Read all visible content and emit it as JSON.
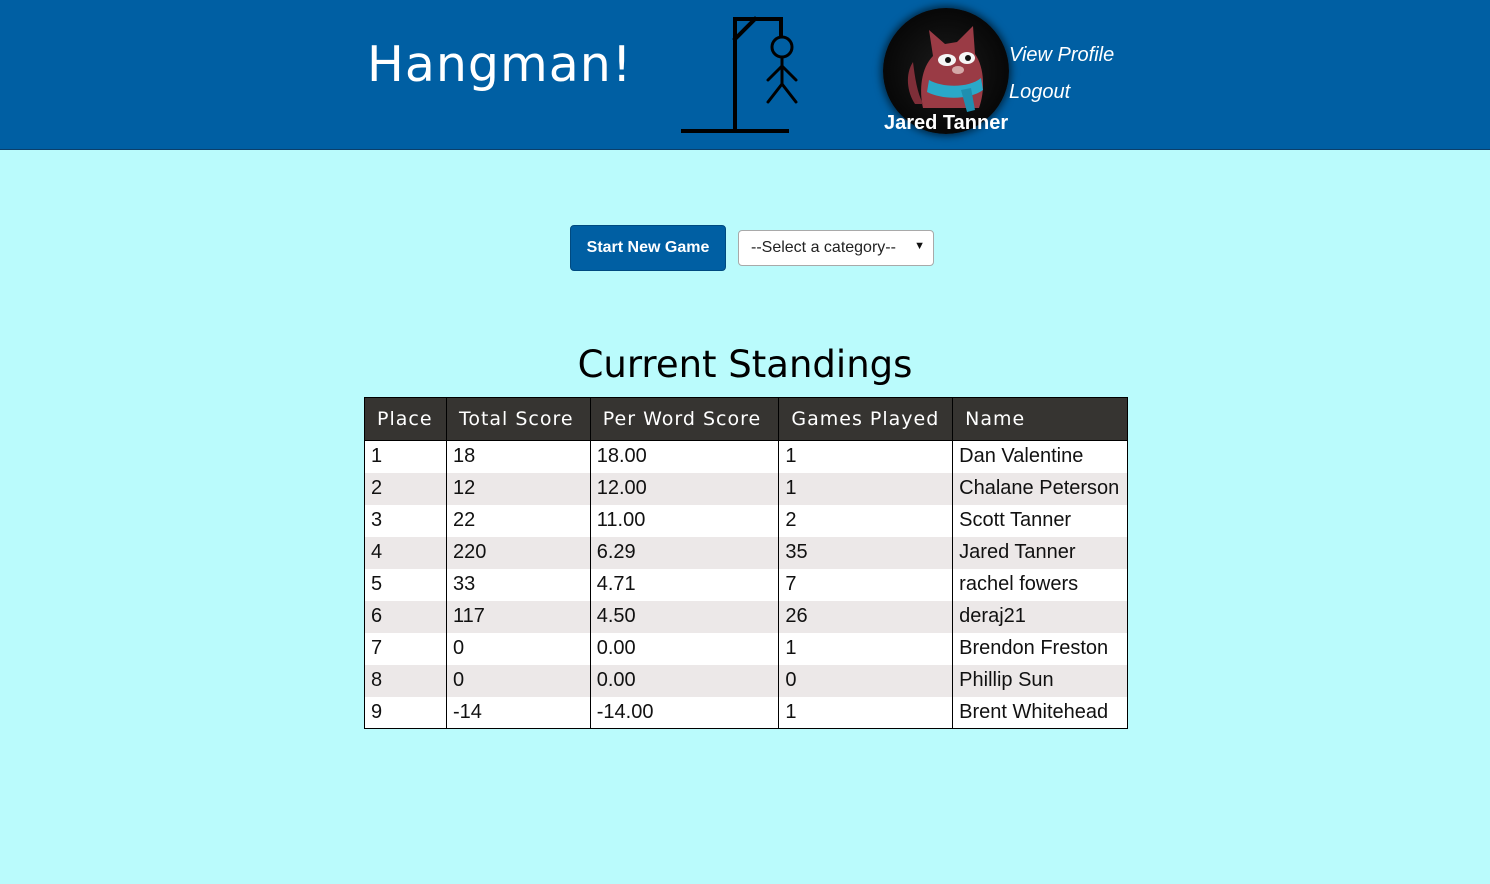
{
  "header": {
    "title": "Hangman!",
    "user_name": "Jared Tanner",
    "nav": {
      "view_profile": "View Profile",
      "logout": "Logout"
    },
    "colors": {
      "header_bg": "#005fa3",
      "page_bg": "#bafbfc"
    }
  },
  "controls": {
    "start_button": "Start New Game",
    "category_select": {
      "selected": "--Select a category--"
    }
  },
  "standings": {
    "title": "Current Standings",
    "columns": [
      "Place",
      "Total Score",
      "Per Word Score",
      "Games Played",
      "Name"
    ],
    "rows": [
      [
        "1",
        "18",
        "18.00",
        "1",
        "Dan Valentine"
      ],
      [
        "2",
        "12",
        "12.00",
        "1",
        "Chalane Peterson"
      ],
      [
        "3",
        "22",
        "11.00",
        "2",
        "Scott Tanner"
      ],
      [
        "4",
        "220",
        "6.29",
        "35",
        "Jared Tanner"
      ],
      [
        "5",
        "33",
        "4.71",
        "7",
        "rachel fowers"
      ],
      [
        "6",
        "117",
        "4.50",
        "26",
        "deraj21"
      ],
      [
        "7",
        "0",
        "0.00",
        "1",
        "Brendon Freston"
      ],
      [
        "8",
        "0",
        "0.00",
        "0",
        "Phillip Sun"
      ],
      [
        "9",
        "-14",
        "-14.00",
        "1",
        "Brent Whitehead"
      ]
    ]
  },
  "icons": {
    "logo": "hangman-gallows-icon",
    "avatar": "cat-avatar"
  }
}
